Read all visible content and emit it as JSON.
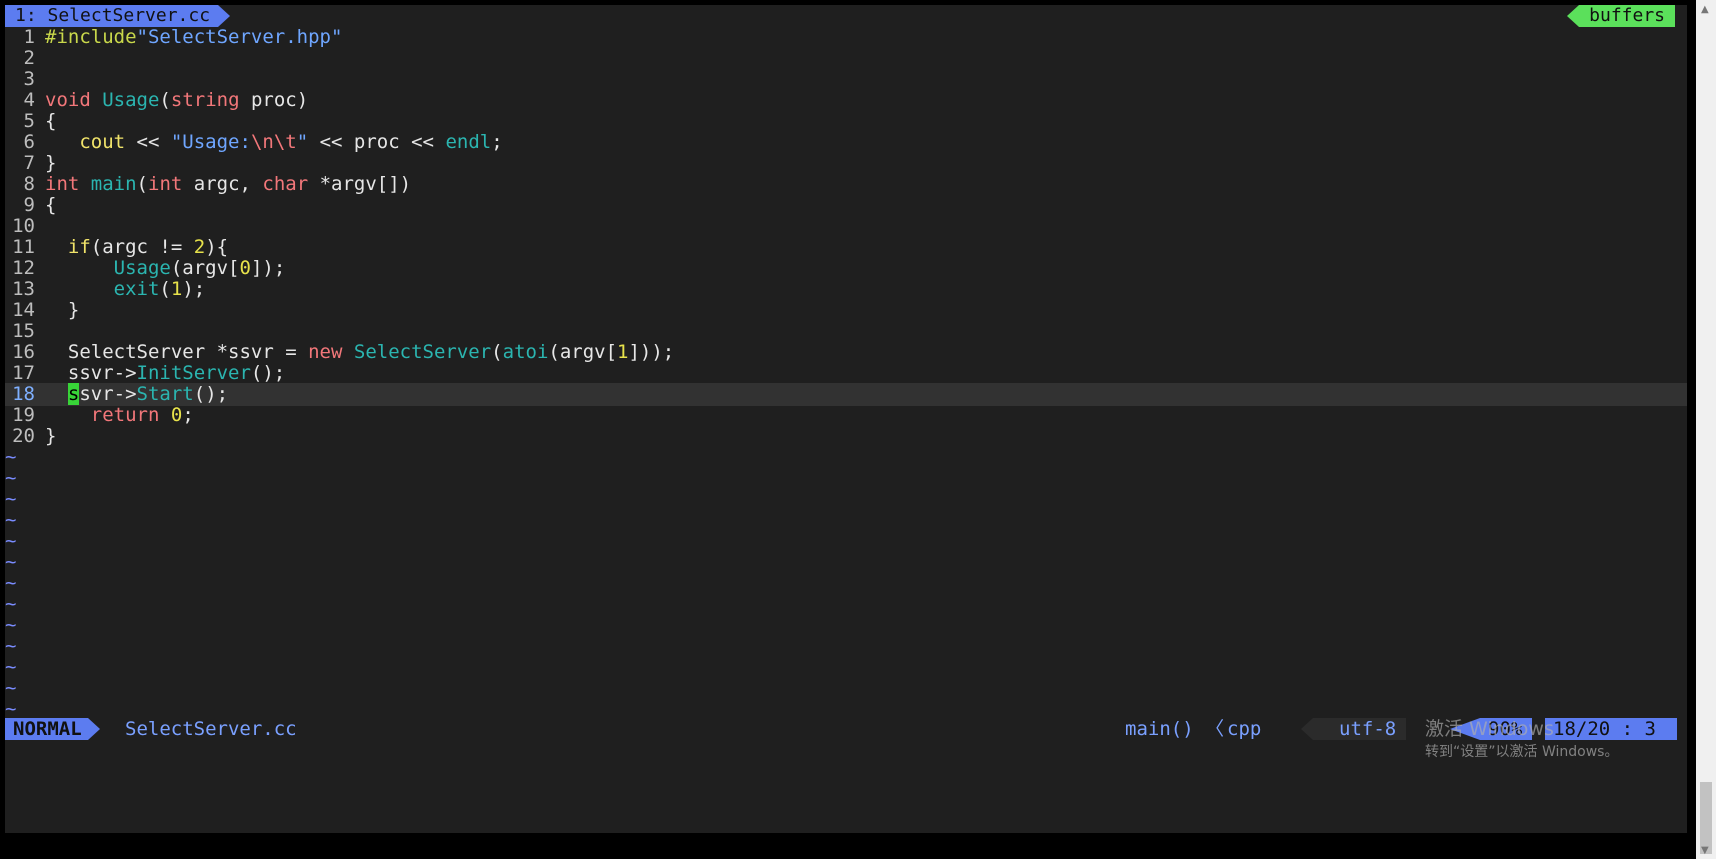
{
  "tabline": {
    "tab_label": "1: SelectServer.cc",
    "buffers_label": "buffers"
  },
  "editor": {
    "lines": [
      {
        "n": "1",
        "tokens": [
          [
            "pp",
            "#include"
          ],
          [
            "st",
            "\"SelectServer.hpp\""
          ]
        ]
      },
      {
        "n": "2",
        "tokens": []
      },
      {
        "n": "3",
        "tokens": []
      },
      {
        "n": "4",
        "tokens": [
          [
            "kw",
            "void"
          ],
          [
            "",
            " "
          ],
          [
            "fn",
            "Usage"
          ],
          [
            "",
            "("
          ],
          [
            "kw",
            "string"
          ],
          [
            "",
            " proc)"
          ]
        ]
      },
      {
        "n": "5",
        "tokens": [
          [
            "",
            "{"
          ]
        ]
      },
      {
        "n": "6",
        "tokens": [
          [
            "",
            "   "
          ],
          [
            "yl",
            "cout"
          ],
          [
            "",
            " << "
          ],
          [
            "st",
            "\"Usage:"
          ],
          [
            "esc",
            "\\n\\t"
          ],
          [
            "st",
            "\""
          ],
          [
            "",
            " << proc << "
          ],
          [
            "fn",
            "endl"
          ],
          [
            "",
            ";"
          ]
        ]
      },
      {
        "n": "7",
        "tokens": [
          [
            "",
            "}"
          ]
        ]
      },
      {
        "n": "8",
        "tokens": [
          [
            "kw",
            "int"
          ],
          [
            "",
            " "
          ],
          [
            "fn",
            "main"
          ],
          [
            "",
            "("
          ],
          [
            "kw",
            "int"
          ],
          [
            "",
            " argc, "
          ],
          [
            "kw",
            "char"
          ],
          [
            "",
            " *argv[])"
          ]
        ]
      },
      {
        "n": "9",
        "tokens": [
          [
            "",
            "{"
          ]
        ]
      },
      {
        "n": "10",
        "tokens": []
      },
      {
        "n": "11",
        "tokens": [
          [
            "",
            "  "
          ],
          [
            "yl",
            "if"
          ],
          [
            "",
            "(argc != "
          ],
          [
            "num",
            "2"
          ],
          [
            "",
            "){"
          ]
        ]
      },
      {
        "n": "12",
        "tokens": [
          [
            "",
            "      "
          ],
          [
            "fn",
            "Usage"
          ],
          [
            "",
            "(argv["
          ],
          [
            "num",
            "0"
          ],
          [
            "",
            "]);"
          ]
        ]
      },
      {
        "n": "13",
        "tokens": [
          [
            "",
            "      "
          ],
          [
            "fn",
            "exit"
          ],
          [
            "",
            "("
          ],
          [
            "num",
            "1"
          ],
          [
            "",
            ");"
          ]
        ]
      },
      {
        "n": "14",
        "tokens": [
          [
            "",
            "  }"
          ]
        ]
      },
      {
        "n": "15",
        "tokens": []
      },
      {
        "n": "16",
        "tokens": [
          [
            "",
            "  SelectServer *ssvr = "
          ],
          [
            "kw",
            "new"
          ],
          [
            "",
            " "
          ],
          [
            "fn",
            "SelectServer"
          ],
          [
            "",
            "("
          ],
          [
            "fn",
            "atoi"
          ],
          [
            "",
            "(argv["
          ],
          [
            "num",
            "1"
          ],
          [
            "",
            "]));"
          ]
        ]
      },
      {
        "n": "17",
        "tokens": [
          [
            "",
            "  ssvr->"
          ],
          [
            "fn",
            "InitServer"
          ],
          [
            "",
            "();"
          ]
        ]
      },
      {
        "n": "18",
        "tokens": [
          [
            "",
            "  "
          ],
          [
            "cursor",
            "s"
          ],
          [
            "",
            "svr->"
          ],
          [
            "fn",
            "Start"
          ],
          [
            "",
            "();"
          ]
        ]
      },
      {
        "n": "19",
        "tokens": [
          [
            "",
            "    "
          ],
          [
            "kw",
            "return"
          ],
          [
            "",
            " "
          ],
          [
            "num",
            "0"
          ],
          [
            "",
            ";"
          ]
        ]
      },
      {
        "n": "20",
        "tokens": [
          [
            "",
            "}"
          ]
        ]
      }
    ],
    "current_line": "18",
    "tilde": "~",
    "tilde_count": 13
  },
  "statusline": {
    "mode": "NORMAL",
    "filename": "SelectServer.cc",
    "function": "main()",
    "separator": "〈",
    "filetype": "cpp",
    "encoding": "utf-8",
    "percent": "90%",
    "position": "18/20 :  3"
  },
  "watermark": {
    "line1": "激活 Windows",
    "line2": "转到“设置”以激活 Windows。"
  },
  "colors": {
    "background": "#1f1f1f",
    "accent_blue": "#5c7cf0",
    "accent_green": "#5be05b",
    "keyword": "#f2777a",
    "function": "#2bb5b0",
    "string": "#6fa6ff",
    "number": "#e7e24b"
  }
}
